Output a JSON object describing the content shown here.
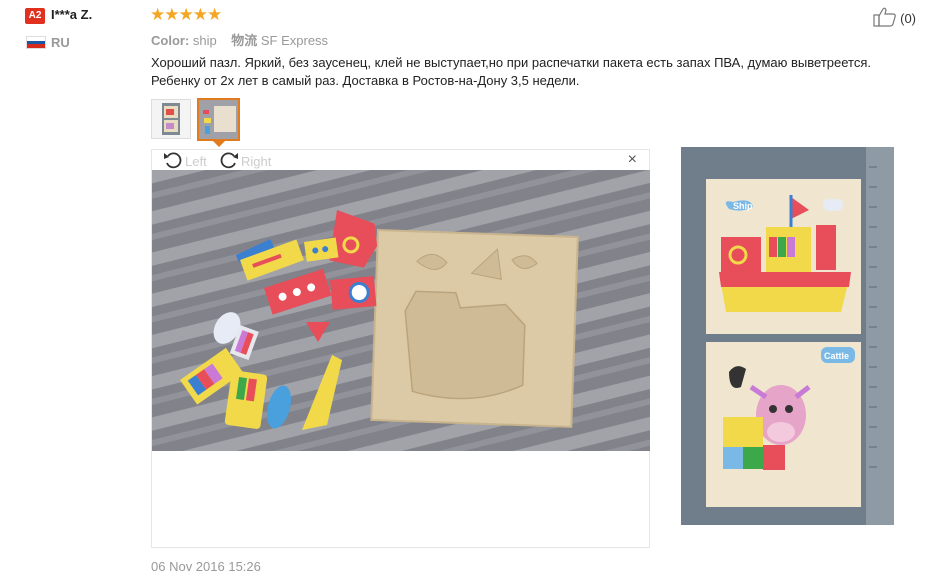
{
  "user": {
    "badge": "A2",
    "name": "I***a Z.",
    "country": "RU"
  },
  "review": {
    "stars_display": "★★★★★",
    "rating": 5,
    "rating_max": 5,
    "likes": "(0)",
    "color_label": "Color:",
    "color_value": "ship",
    "shipping_label": "物流",
    "shipping_value": "SF Express",
    "text_line1": "Хороший пазл. Яркий, без заусенец, клей не выступает,но при распечатки пакета есть запах ПВА, думаю выветреется.",
    "text_line2": "Ребенку от 2х лет в самый раз. Доставка в Ростов-на-Дону 3,5 недели.",
    "date": "06 Nov 2016 15:26"
  },
  "preview": {
    "rotate_left_label": "Left",
    "rotate_right_label": "Right",
    "close_label": "×"
  },
  "photo_text": {
    "ship": "Ship",
    "cattle": "Cattle"
  },
  "colors": {
    "star": "#f5a623",
    "badge": "#e0301e",
    "active_thumb_border": "#e07b1e"
  },
  "icons": [
    "rotate-left-icon",
    "rotate-right-icon",
    "close-icon",
    "thumbs-up-icon",
    "flag-ru-icon"
  ]
}
